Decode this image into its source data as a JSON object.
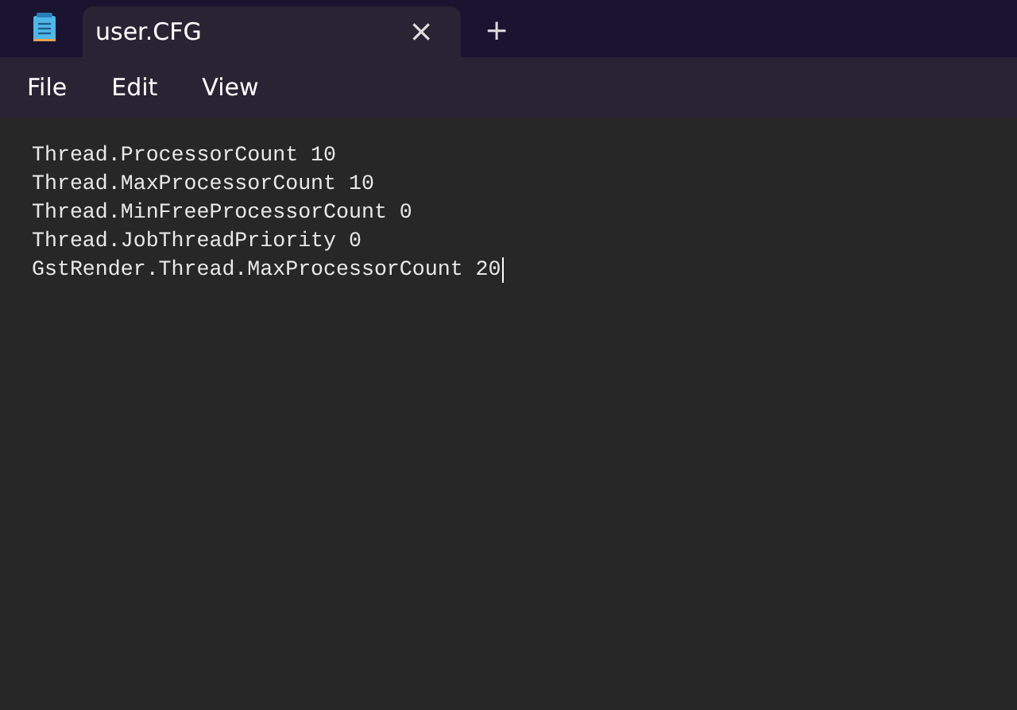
{
  "tabs": [
    {
      "label": "user.CFG",
      "selected": true,
      "close": "×"
    }
  ],
  "new_tab": "+",
  "menu": [
    "File",
    "Edit",
    "View"
  ],
  "editor": {
    "lines": [
      "Thread.ProcessorCount 10",
      "Thread.MaxProcessorCount 10",
      "Thread.MinFreeProcessorCount 0",
      "Thread.JobThreadPriority 0",
      "GstRender.Thread.MaxProcessorCount 20"
    ]
  }
}
